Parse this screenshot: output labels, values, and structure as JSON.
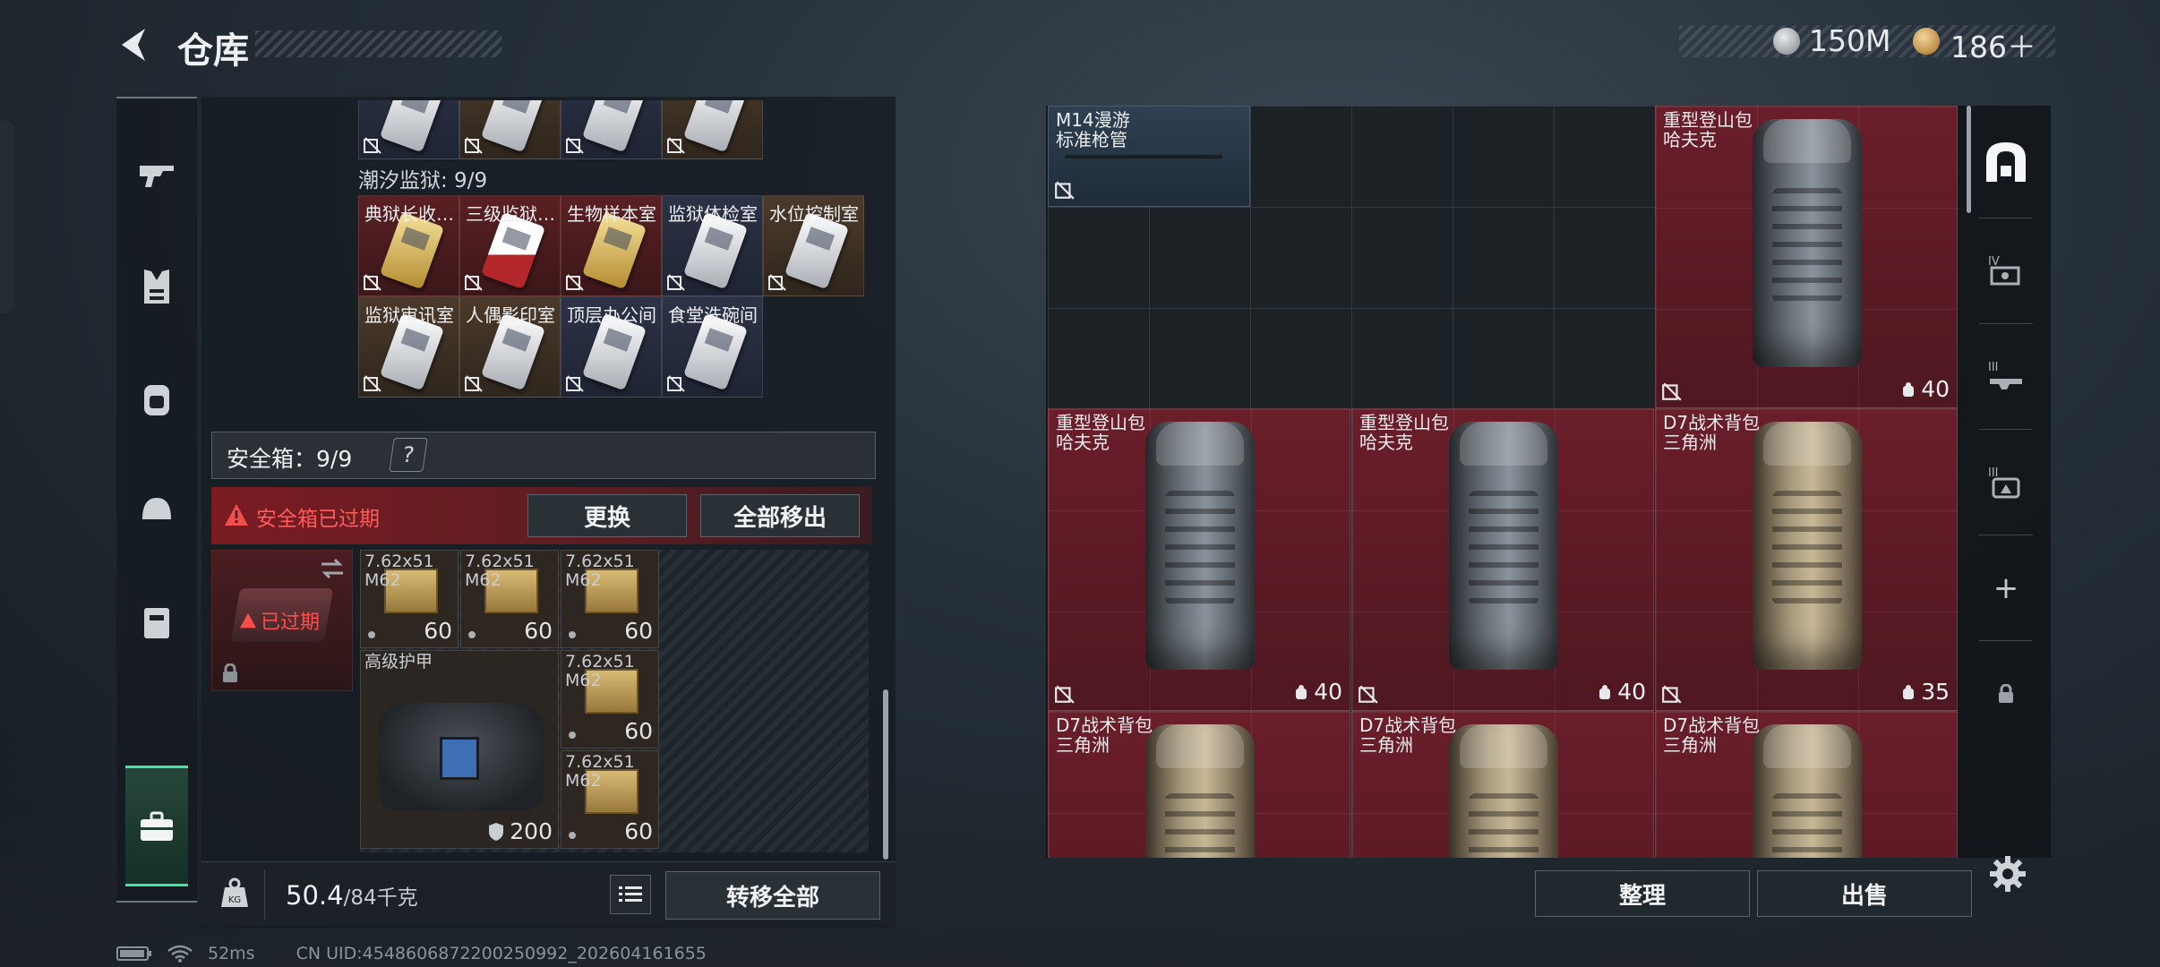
{
  "header": {
    "title": "仓库"
  },
  "currency": {
    "silver": "150M",
    "gold": "186＋"
  },
  "nav": {
    "items": [
      "guns",
      "armor",
      "backpack",
      "helmet",
      "chest-rig",
      "safe-box"
    ],
    "active": "safe-box"
  },
  "prison_section": {
    "label": "潮汐监狱: 9/9",
    "cards": [
      {
        "name": "典狱长收…",
        "color": "red",
        "card": "gold"
      },
      {
        "name": "三级监狱…",
        "color": "red",
        "card": "red"
      },
      {
        "name": "生物样本室",
        "color": "red",
        "card": "gold"
      },
      {
        "name": "监狱体检室",
        "color": "navy",
        "card": "white"
      },
      {
        "name": "水位控制室",
        "color": "brown",
        "card": "white"
      },
      {
        "name": "监狱审讯室",
        "color": "brown",
        "card": "white"
      },
      {
        "name": "人偶影印室",
        "color": "brown",
        "card": "white"
      },
      {
        "name": "顶层办公间",
        "color": "navy",
        "card": "white"
      },
      {
        "name": "食堂洗碗间",
        "color": "navy",
        "card": "white"
      }
    ]
  },
  "safebox": {
    "label": "安全箱：9/9",
    "help": "?",
    "warning": "安全箱已过期",
    "replace_btn": "更换",
    "remove_all_btn": "全部移出",
    "expired_label": "已过期"
  },
  "safebox_items": [
    {
      "label": "7.62x51\nM62",
      "count": "60"
    },
    {
      "label": "7.62x51\nM62",
      "count": "60"
    },
    {
      "label": "7.62x51\nM62",
      "count": "60"
    },
    {
      "label": "高级护甲",
      "count": "200"
    },
    {
      "label": "7.62x51\nM62",
      "count": "60"
    },
    {
      "label": "7.62x51\nM62",
      "count": "60"
    }
  ],
  "weight": {
    "value": "50.4",
    "capacity": "/84千克"
  },
  "transfer_all_btn": "转移全部",
  "stash_items": [
    {
      "name": "M14漫游\n标准枪管",
      "count": "",
      "kind": "m14"
    },
    {
      "name": "重型登山包\n哈夫克",
      "count": "40",
      "kind": "grey"
    },
    {
      "name": "重型登山包\n哈夫克",
      "count": "40",
      "kind": "grey"
    },
    {
      "name": "重型登山包\n哈夫克",
      "count": "40",
      "kind": "grey"
    },
    {
      "name": "D7战术背包\n三角洲",
      "count": "35",
      "kind": "tan"
    },
    {
      "name": "D7战术背包\n三角洲",
      "count": "",
      "kind": "tan"
    },
    {
      "name": "D7战术背包\n三角洲",
      "count": "",
      "kind": "tan"
    },
    {
      "name": "D7战术背包\n三角洲",
      "count": "",
      "kind": "tan"
    }
  ],
  "right_buttons": {
    "sort": "整理",
    "sell": "出售"
  },
  "right_rail": {
    "plus": "+"
  },
  "status": {
    "ping": "52ms",
    "uid": "CN UID:4548606872200250992_202604161655"
  }
}
